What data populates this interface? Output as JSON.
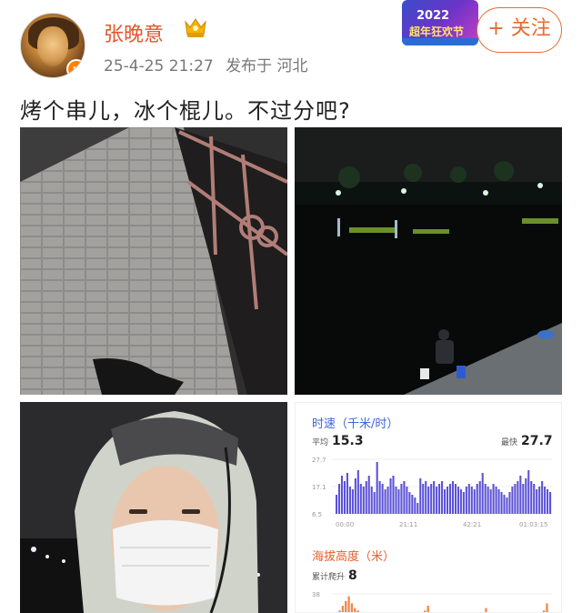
{
  "user": {
    "name": "张晚意",
    "avatar_badge": "v",
    "post_time": "25-4-25 21:27",
    "location": "发布于 河北"
  },
  "promo": {
    "year": "2022",
    "name": "超年狂欢节"
  },
  "actions": {
    "follow_label": "+ 关注"
  },
  "post": {
    "text": "烤个串儿，冰个棍儿。不过分吧?"
  },
  "stats_card": {
    "speed_title": "时速（千米/时）",
    "avg_label": "平均",
    "avg_value": "15.3",
    "max_label": "最快",
    "max_value": "27.7",
    "y_ticks": [
      "27.7",
      "17.1",
      "6.5"
    ],
    "x_ticks": [
      "00:00",
      "21:11",
      "42:21",
      "01:03:15"
    ],
    "elev_title": "海拔高度（米）",
    "climb_label": "累计爬升",
    "climb_value": "8",
    "elev_tick": "38",
    "speed_bars": [
      0.35,
      0.55,
      0.7,
      0.6,
      0.75,
      0.5,
      0.45,
      0.65,
      0.8,
      0.55,
      0.5,
      0.6,
      0.7,
      0.5,
      0.4,
      0.95,
      0.6,
      0.55,
      0.45,
      0.5,
      0.65,
      0.7,
      0.5,
      0.45,
      0.55,
      0.6,
      0.5,
      0.4,
      0.35,
      0.3,
      0.2,
      0.65,
      0.55,
      0.6,
      0.5,
      0.55,
      0.6,
      0.5,
      0.55,
      0.6,
      0.45,
      0.5,
      0.55,
      0.6,
      0.55,
      0.5,
      0.45,
      0.4,
      0.5,
      0.55,
      0.5,
      0.45,
      0.55,
      0.6,
      0.75,
      0.55,
      0.5,
      0.45,
      0.55,
      0.5,
      0.45,
      0.4,
      0.35,
      0.3,
      0.4,
      0.5,
      0.55,
      0.6,
      0.7,
      0.55,
      0.65,
      0.8,
      0.6,
      0.55,
      0.45,
      0.5,
      0.6,
      0.5,
      0.45,
      0.4
    ],
    "elev_bars": [
      0.2,
      0.3,
      0.5,
      0.7,
      0.9,
      0.6,
      0.4,
      0.3,
      0.2,
      0.1,
      0.0,
      0.0,
      0.0,
      0.0,
      0.0,
      0.0,
      0.0,
      0.0,
      0.0,
      0.0,
      0.0,
      0.0,
      0.0,
      0.0,
      0.0,
      0.0,
      0.0,
      0.0,
      0.0,
      0.3,
      0.5,
      0.2,
      0.0,
      0.0,
      0.0,
      0.0,
      0.0,
      0.0,
      0.0,
      0.0,
      0.0,
      0.0,
      0.0,
      0.0,
      0.0,
      0.0,
      0.0,
      0.0,
      0.0,
      0.4,
      0.0,
      0.0,
      0.0,
      0.0,
      0.0,
      0.0,
      0.0,
      0.0,
      0.0,
      0.0,
      0.0,
      0.0,
      0.0,
      0.0,
      0.0,
      0.0,
      0.0,
      0.0,
      0.3,
      0.6,
      0.2
    ]
  },
  "colors": {
    "username": "#e6542e",
    "follow": "#e86b2c",
    "speed_bar": "#5b51d8",
    "elev_bar": "#f08a4b"
  }
}
